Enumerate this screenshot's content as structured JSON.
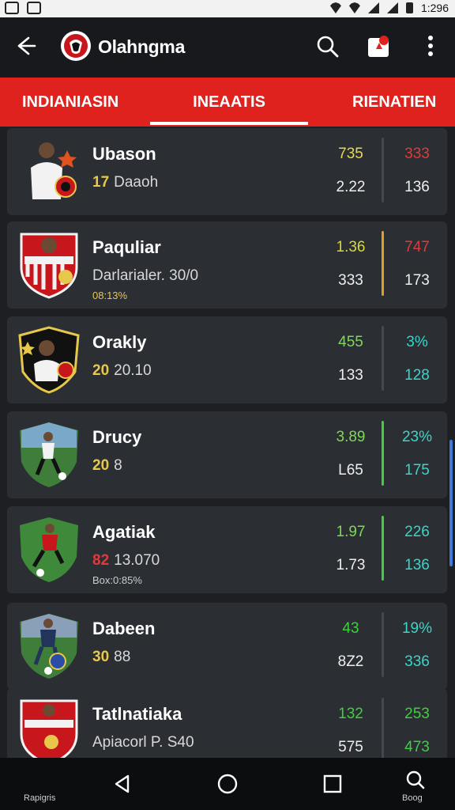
{
  "status_bar": {
    "time": "1:296"
  },
  "app_bar": {
    "title": "Olahngma"
  },
  "tabs": [
    {
      "label": "INDIANIASIN"
    },
    {
      "label": "INEAATIS"
    },
    {
      "label": "RIENATIEN"
    }
  ],
  "rows": [
    {
      "name": "Ubason",
      "sub_num": "17",
      "sub_text": "Daaoh",
      "note": "",
      "v1": "735",
      "v2": "2.22",
      "v3": "333",
      "v4": "136",
      "v1_color": "#e8d84a",
      "v3_color": "#e03a3a",
      "v4_color": "#eeeeee",
      "divider_color": "#45484e",
      "num_color": "#e8c84a"
    },
    {
      "name": "Paquliar",
      "sub_num": "",
      "sub_text": "Darlarialer. 30/0",
      "note": "08:13%",
      "v1": "1.36",
      "v2": "333",
      "v3": "747",
      "v4": "173",
      "v1_color": "#d8d840",
      "v3_color": "#e03a3a",
      "v4_color": "#eeeeee",
      "divider_color": "#e0a020",
      "num_color": "#e8c84a"
    },
    {
      "name": "Orakly",
      "sub_num": "20",
      "sub_text": "20.10",
      "note": "",
      "v1": "455",
      "v2": "133",
      "v3": "3%",
      "v4": "128",
      "v1_color": "#7ed957",
      "v3_color": "#3ad6c8",
      "v4_color": "#3ad6c8",
      "divider_color": "#45484e",
      "num_color": "#e8c84a"
    },
    {
      "name": "Drucy",
      "sub_num": "20",
      "sub_text": "8",
      "note": "",
      "v1": "3.89",
      "v2": "L65",
      "v3": "23%",
      "v4": "175",
      "v1_color": "#7ed957",
      "v3_color": "#3ad6c8",
      "v4_color": "#3ad6c8",
      "divider_color": "#3fd03f",
      "num_color": "#e8c84a"
    },
    {
      "name": "Agatiak",
      "sub_num": "82",
      "sub_text": "13.070",
      "note": "Box:0:85%",
      "v1": "1.97",
      "v2": "1.73",
      "v3": "226",
      "v4": "136",
      "v1_color": "#7ed957",
      "v3_color": "#3ad6c8",
      "v4_color": "#3ad6c8",
      "divider_color": "#3fd03f",
      "num_color": "#e03a3a"
    },
    {
      "name": "Dabeen",
      "sub_num": "30",
      "sub_text": "88",
      "note": "",
      "v1": "43",
      "v2": "8Z2",
      "v3": "19%",
      "v4": "336",
      "v1_color": "#3fd03f",
      "v3_color": "#3ad6c8",
      "v4_color": "#3ad6c8",
      "divider_color": "#45484e",
      "num_color": "#e8c84a"
    },
    {
      "name": "Tatlnatiaka",
      "sub_num": "",
      "sub_text": "Apiacorl P. S40",
      "note": "",
      "v1": "132",
      "v2": "575",
      "v3": "253",
      "v4": "473",
      "v1_color": "#3fd03f",
      "v3_color": "#3fd03f",
      "v4_color": "#3fd03f",
      "divider_color": "#45484e",
      "num_color": "#e8c84a"
    }
  ],
  "nav": {
    "left_label": "Rapigris",
    "right_label": "Boog"
  }
}
